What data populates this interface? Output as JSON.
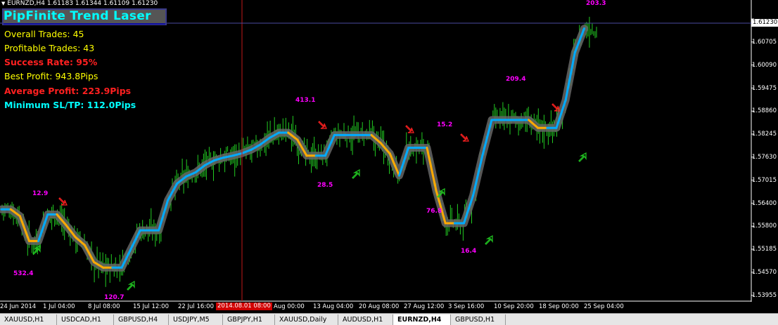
{
  "window": {
    "symbol_line": "EURNZD,H4  1.61183 1.61344 1.61109 1.61230"
  },
  "indicator": {
    "title": "PipFinite Trend Laser",
    "stats": [
      {
        "text": "Overall Trades: 45",
        "style": "yellow"
      },
      {
        "text": "Profitable Trades: 43",
        "style": "yellow"
      },
      {
        "text": "Success Rate: 95%",
        "style": "red"
      },
      {
        "text": "Best Profit: 943.8Pips",
        "style": "yellow"
      },
      {
        "text": "Average Profit: 223.9Pips",
        "style": "red"
      },
      {
        "text": "Minimum SL/TP: 112.0Pips",
        "style": "cyan"
      }
    ]
  },
  "price_axis": {
    "current_price": "1.61230",
    "ticks": [
      "1.61230",
      "1.60705",
      "1.60090",
      "1.59475",
      "1.58860",
      "1.58245",
      "1.57630",
      "1.57015",
      "1.56400",
      "1.55800",
      "1.55185",
      "1.54570",
      "1.53955"
    ]
  },
  "time_axis": {
    "labels": [
      "24 Jun 2014",
      "1 Jul 04:00",
      "8 Jul 08:00",
      "15 Jul 12:00",
      "22 Jul 16:00",
      "Aug 00:00",
      "13 Aug 04:00",
      "20 Aug 08:00",
      "27 Aug 12:00",
      "3 Sep 16:00",
      "10 Sep 20:00",
      "18 Sep 00:00",
      "25 Sep 04:00"
    ],
    "highlight": "2014.08.01 08:00"
  },
  "signals": [
    "12.9",
    "532.4",
    "120.7",
    "413.1",
    "28.5",
    "15.2",
    "76.8",
    "16.4",
    "209.4",
    "203.3"
  ],
  "tabs": [
    {
      "label": "XAUUSD,H1",
      "active": false
    },
    {
      "label": "USDCAD,H1",
      "active": false
    },
    {
      "label": "GBPUSD,H4",
      "active": false
    },
    {
      "label": "USDJPY,M5",
      "active": false
    },
    {
      "label": "GBPJPY,H1",
      "active": false
    },
    {
      "label": "XAUUSD,Daily",
      "active": false
    },
    {
      "label": "AUDUSD,H1",
      "active": false
    },
    {
      "label": "EURNZD,H4",
      "active": true
    },
    {
      "label": "GBPUSD,H1",
      "active": false
    }
  ],
  "colors": {
    "background": "#000000",
    "bars": "#22cc22",
    "trend_up": "#00aaff",
    "trend_down": "#ffaa00",
    "laser_glow": "#666666",
    "signal_text": "#ff00ff",
    "up_arrow": "#22cc22",
    "down_arrow": "#ff2020",
    "crosshair_v": "#c01818",
    "crosshair_h": "#4a4aa0"
  },
  "chart_data": {
    "type": "line",
    "title": "",
    "xlabel": "",
    "ylabel": "",
    "ylim": [
      1.53955,
      1.6152
    ],
    "series": [
      {
        "values": [
          1.5625,
          1.5625,
          1.5608,
          1.5545,
          1.5545,
          1.5612,
          1.5612,
          1.5585,
          1.5555,
          1.5535,
          1.5492,
          1.5478,
          1.5478,
          1.5478,
          1.5525,
          1.5572,
          1.5572,
          1.5572,
          1.5648,
          1.569,
          1.5708,
          1.5718,
          1.5736,
          1.5748,
          1.5755,
          1.576,
          1.5766,
          1.5775,
          1.5788,
          1.5805,
          1.5818,
          1.5818,
          1.58,
          1.576,
          1.576,
          1.576,
          1.5812,
          1.5812,
          1.5812,
          1.5812,
          1.5812,
          1.5792,
          1.5765,
          1.571,
          1.578,
          1.578,
          1.578,
          1.5672,
          1.559,
          1.559,
          1.559,
          1.566,
          1.576,
          1.585,
          1.585,
          1.585,
          1.585,
          1.585,
          1.583,
          1.583,
          1.583,
          1.59,
          1.602,
          1.608
        ]
      }
    ]
  }
}
